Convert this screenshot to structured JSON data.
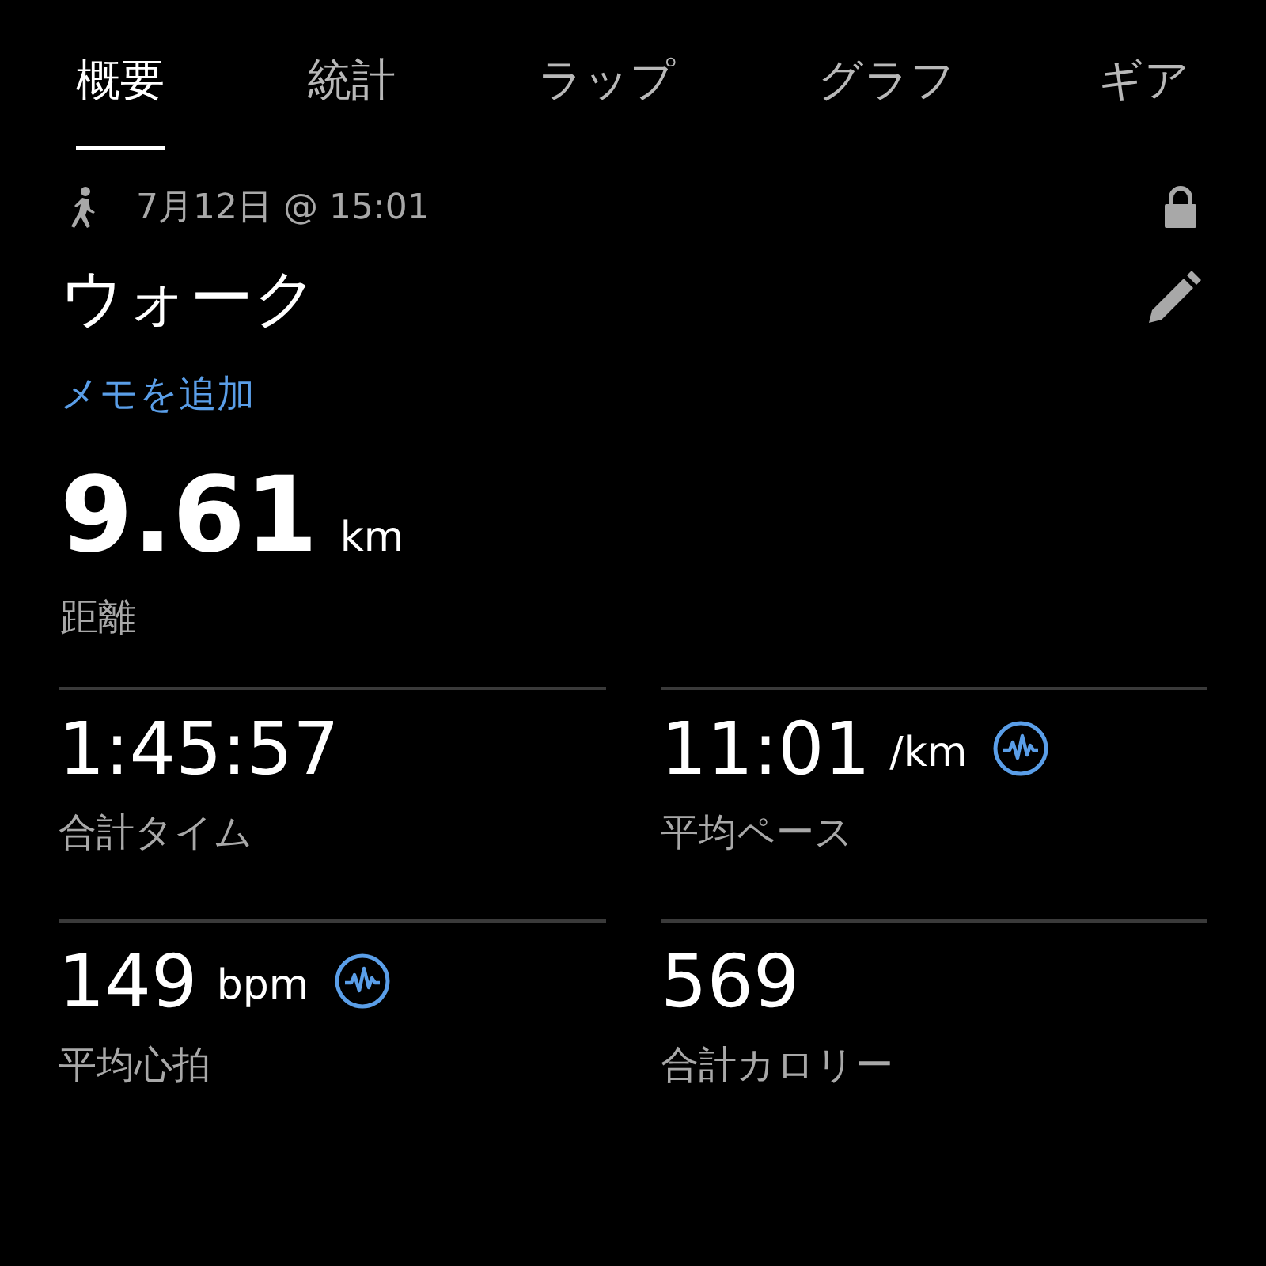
{
  "tabs": [
    {
      "label": "概要",
      "selected": true
    },
    {
      "label": "統計",
      "selected": false
    },
    {
      "label": "ラップ",
      "selected": false
    },
    {
      "label": "グラフ",
      "selected": false
    },
    {
      "label": "ギア",
      "selected": false
    }
  ],
  "header": {
    "date": "7月12日 @ 15:01",
    "locked": true
  },
  "activity": {
    "title": "ウォーク",
    "add_note": "メモを追加"
  },
  "distance": {
    "value": "9.61",
    "unit": "km",
    "label": "距離"
  },
  "stats": [
    {
      "value": "1:45:57",
      "label": "合計タイム",
      "detail_icon": false
    },
    {
      "value": "11:01",
      "unit": "/km",
      "label": "平均ペース",
      "detail_icon": true
    },
    {
      "value": "149",
      "unit": "bpm",
      "label": "平均心拍",
      "detail_icon": true
    },
    {
      "value": "569",
      "label": "合計カロリー",
      "detail_icon": false
    }
  ]
}
